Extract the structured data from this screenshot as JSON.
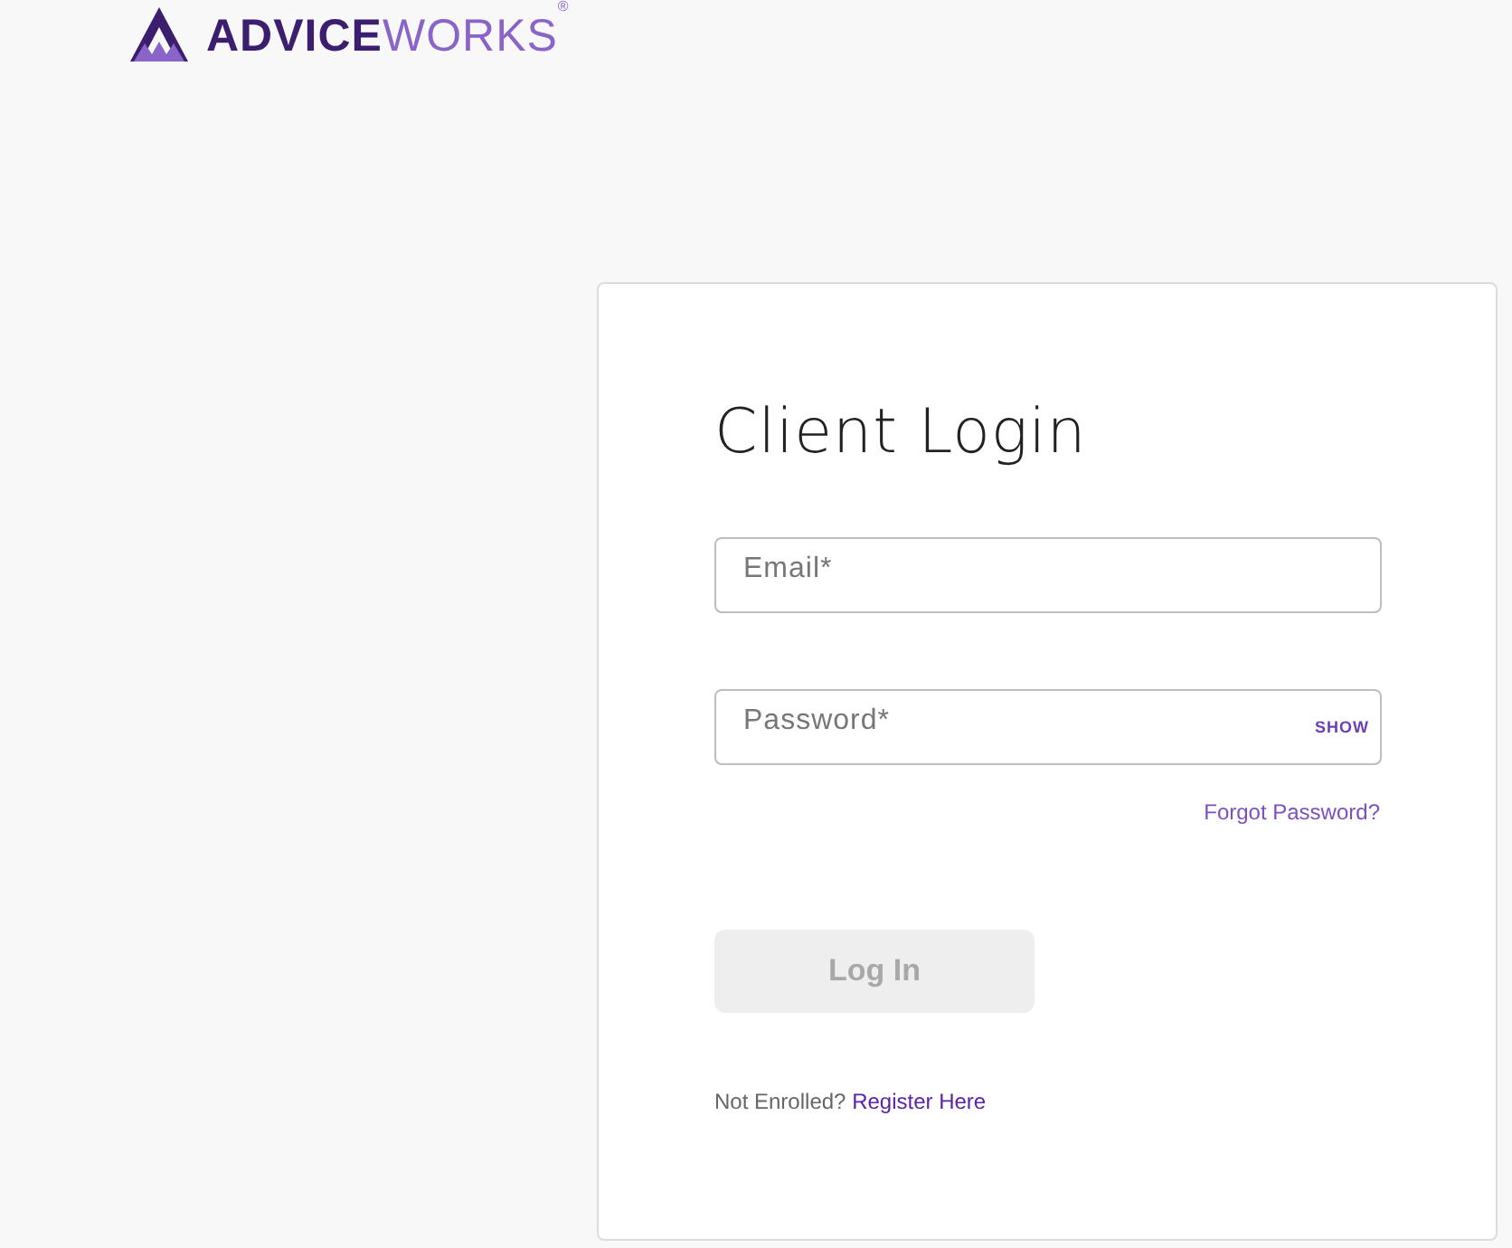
{
  "logo": {
    "primary": "ADVICE",
    "secondary": "WORKS",
    "mark": "®"
  },
  "login": {
    "title": "Client Login",
    "fields": [
      {
        "placeholder": "Email*"
      },
      {
        "placeholder": "Password*",
        "toggle": "SHOW"
      }
    ],
    "forgot_link": "Forgot Password?",
    "submit": {
      "label": "Log In",
      "disabled": true
    },
    "register_prompt": "Not Enrolled?",
    "register_link": "Register Here"
  }
}
